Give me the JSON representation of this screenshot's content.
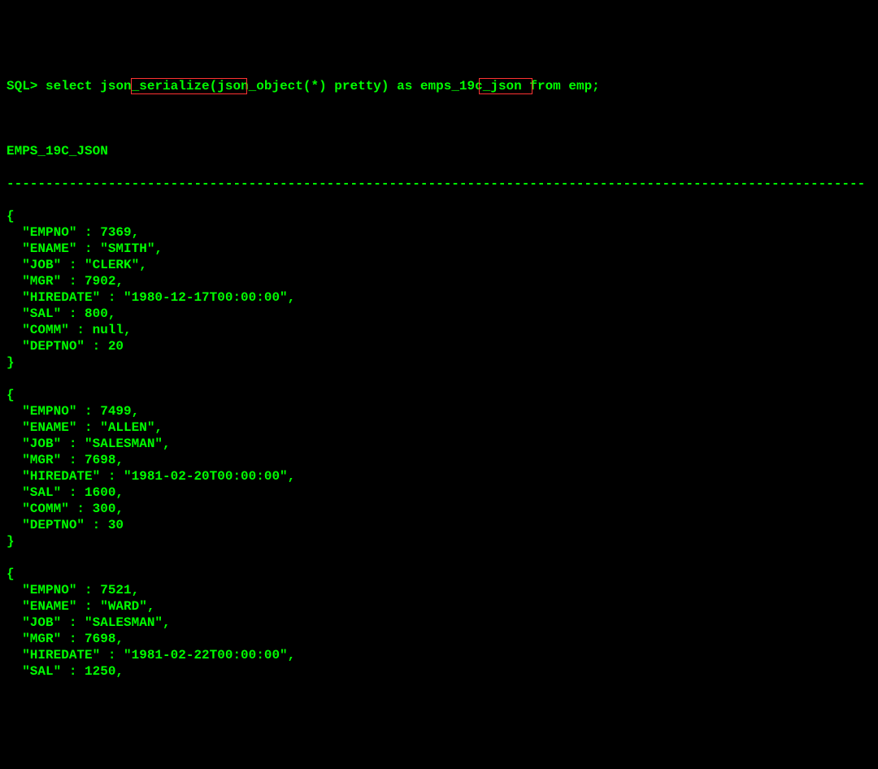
{
  "prompt": "SQL>",
  "sql_keywords": {
    "select": "select",
    "json_serialize": "json_serialize",
    "json_object_star": "(json_object(*)",
    "pretty": "pretty",
    "as": ") as",
    "alias": "emps_19c_json",
    "from": "from",
    "table": "emp;"
  },
  "column_header": "EMPS_19C_JSON",
  "separator": "--------------------------------------------------------------------------------------------------------------",
  "records": [
    {
      "open": "{",
      "lines": [
        "  \"EMPNO\" : 7369,",
        "  \"ENAME\" : \"SMITH\",",
        "  \"JOB\" : \"CLERK\",",
        "  \"MGR\" : 7902,",
        "  \"HIREDATE\" : \"1980-12-17T00:00:00\",",
        "  \"SAL\" : 800,",
        "  \"COMM\" : null,",
        "  \"DEPTNO\" : 20"
      ],
      "close": "}"
    },
    {
      "open": "{",
      "lines": [
        "  \"EMPNO\" : 7499,",
        "  \"ENAME\" : \"ALLEN\",",
        "  \"JOB\" : \"SALESMAN\",",
        "  \"MGR\" : 7698,",
        "  \"HIREDATE\" : \"1981-02-20T00:00:00\",",
        "  \"SAL\" : 1600,",
        "  \"COMM\" : 300,",
        "  \"DEPTNO\" : 30"
      ],
      "close": "}"
    },
    {
      "open": "{",
      "lines": [
        "  \"EMPNO\" : 7521,",
        "  \"ENAME\" : \"WARD\",",
        "  \"JOB\" : \"SALESMAN\",",
        "  \"MGR\" : 7698,",
        "  \"HIREDATE\" : \"1981-02-22T00:00:00\",",
        "  \"SAL\" : 1250,"
      ],
      "close": ""
    }
  ]
}
